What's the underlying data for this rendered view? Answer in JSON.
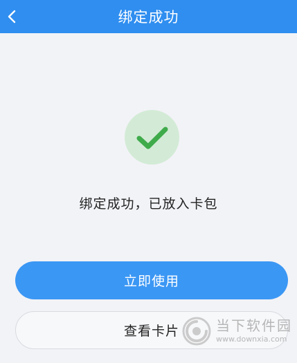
{
  "colors": {
    "header_bg": "#2f8ef0",
    "page_bg": "#f2f3f7",
    "success_circle_bg": "#d3ebd6",
    "success_check": "#3fab4b",
    "primary_button_bg": "#3b97f4"
  },
  "header": {
    "back_icon": "chevron-left-icon",
    "title": "绑定成功"
  },
  "status": {
    "icon": "checkmark-icon",
    "message": "绑定成功，已放入卡包"
  },
  "actions": {
    "primary_label": "立即使用",
    "secondary_label": "查看卡片"
  },
  "watermark": {
    "text": "当下软件园",
    "url": "www.downxia.com"
  }
}
